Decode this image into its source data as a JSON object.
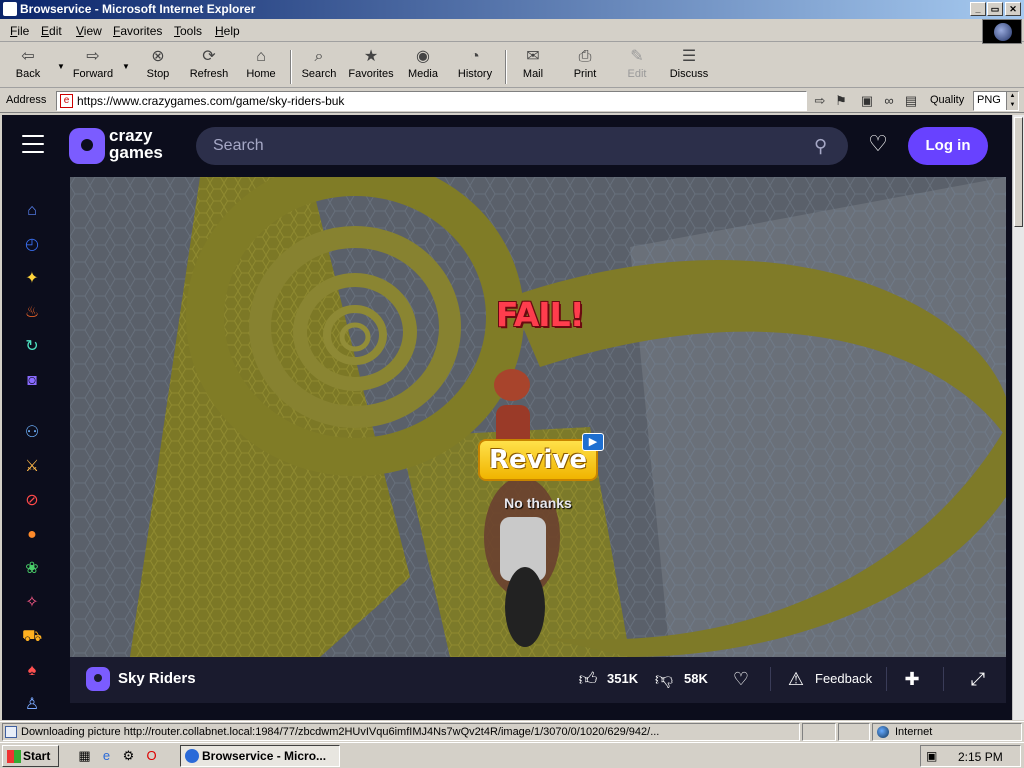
{
  "window": {
    "title": "Browservice - Microsoft Internet Explorer",
    "controls": {
      "minimize": "_",
      "maximize": "▭",
      "close": "✕"
    }
  },
  "menu": [
    {
      "key": "F",
      "rest": "ile"
    },
    {
      "key": "E",
      "rest": "dit"
    },
    {
      "key": "V",
      "rest": "iew"
    },
    {
      "key": "F",
      "rest": "avorites"
    },
    {
      "key": "T",
      "rest": "ools"
    },
    {
      "key": "H",
      "rest": "elp"
    }
  ],
  "toolbar": {
    "back": "Back",
    "forward": "Forward",
    "stop": "Stop",
    "refresh": "Refresh",
    "home": "Home",
    "search": "Search",
    "favorites": "Favorites",
    "media": "Media",
    "history": "History",
    "mail": "Mail",
    "print": "Print",
    "edit": "Edit",
    "discuss": "Discuss"
  },
  "address": {
    "label": "Address",
    "url": "https://www.crazygames.com/game/sky-riders-buk",
    "quality_label": "Quality",
    "quality_value": "PNG"
  },
  "site": {
    "logo_line1": "crazy",
    "logo_line2": "games",
    "search_placeholder": "Search",
    "login": "Log in",
    "accent": "#6842ff",
    "rail_icons": [
      "home-icon",
      "clock-icon",
      "sparkle-icon",
      "fire-icon",
      "refresh-icon",
      "controller-icon",
      "multiplayer-icon",
      "sword-icon",
      "compass-icon",
      "basketball-icon",
      "flower-icon",
      "ribbon-icon",
      "car-icon",
      "cards-icon",
      "stamp-icon"
    ]
  },
  "game": {
    "fail_text": "FAIL!",
    "revive": "Revive",
    "no_thanks": "No thanks",
    "title": "Sky Riders",
    "likes": "351K",
    "dislikes": "58K",
    "feedback": "Feedback"
  },
  "status": {
    "text": "Downloading picture http://router.collabnet.local:1984/77/zbcdwm2HUvIVqu6imfIMJ4Ns7wQv2t4R/image/1/3070/0/1020/629/942/...",
    "zone": "Internet"
  },
  "taskbar": {
    "start": "Start",
    "task": "Browservice - Micro...",
    "clock": "2:15 PM"
  }
}
